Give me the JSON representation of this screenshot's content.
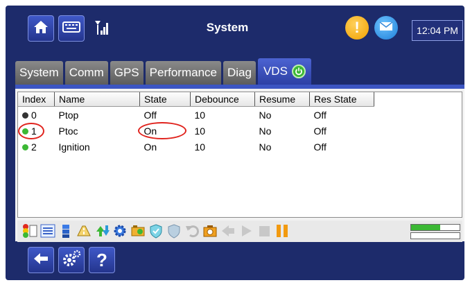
{
  "header": {
    "title": "System",
    "time": "12:04 PM",
    "home_icon": "home-icon",
    "keyboard_icon": "keyboard-icon",
    "signal_icon": "signal-icon",
    "alert_icon": "alert-icon",
    "message_icon": "message-icon"
  },
  "tabs": [
    {
      "label": "System",
      "active": false
    },
    {
      "label": "Comm",
      "active": false
    },
    {
      "label": "GPS",
      "active": false
    },
    {
      "label": "Performance",
      "active": false
    },
    {
      "label": "Diag",
      "active": false
    },
    {
      "label": "VDS",
      "active": true,
      "icon": "power-icon"
    }
  ],
  "table": {
    "columns": [
      "Index",
      "Name",
      "State",
      "Debounce",
      "Resume",
      "Res State"
    ],
    "rows": [
      {
        "index": "0",
        "name": "Ptop",
        "state": "Off",
        "debounce": "10",
        "resume": "No",
        "res_state": "Off",
        "status_color": "#333333"
      },
      {
        "index": "1",
        "name": "Ptoc",
        "state": "On",
        "debounce": "10",
        "resume": "No",
        "res_state": "Off",
        "status_color": "#3cb835"
      },
      {
        "index": "2",
        "name": "Ignition",
        "state": "On",
        "debounce": "10",
        "resume": "No",
        "res_state": "Off",
        "status_color": "#3cb835"
      }
    ]
  },
  "toolbar": {
    "icons": [
      "status-lights-icon",
      "list-icon",
      "stack-icon",
      "road-icon",
      "transfer-icon",
      "gear-icon",
      "diagnostics-icon",
      "shield-icon",
      "shield-plain-icon",
      "undo-icon",
      "camera-icon",
      "forward-icon",
      "play-icon",
      "stop-icon",
      "pause-icon"
    ],
    "progress": 0.6
  },
  "footer": {
    "back_icon": "back-arrow-icon",
    "settings_icon": "settings-icon",
    "help_label": "?"
  },
  "colors": {
    "background": "#1d2b6b",
    "active_tab": "#3c55c2",
    "inactive_tab": "#6e6e6e",
    "annotation": "#e0231d",
    "progress": "#3cb835"
  }
}
